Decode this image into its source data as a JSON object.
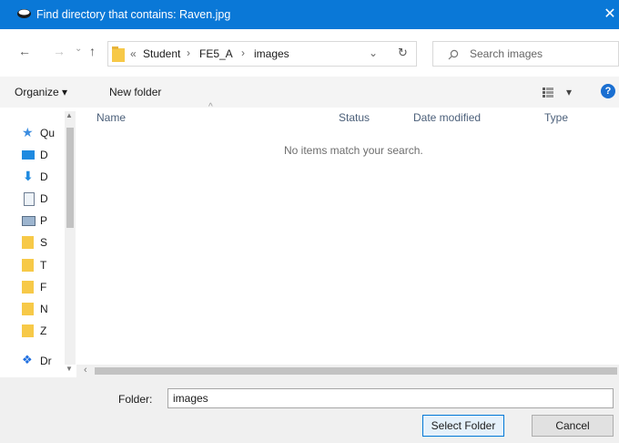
{
  "window": {
    "title": "Find directory that contains: Raven.jpg",
    "close_glyph": "✕"
  },
  "nav": {
    "back_glyph": "←",
    "forward_glyph": "→",
    "dropdown_glyph": "⌄",
    "up_glyph": "↑",
    "breadcrumb_prefix": "«",
    "crumbs": [
      "Student",
      "FE5_A",
      "images"
    ],
    "crumb_sep": "›",
    "refresh_glyph": "↻",
    "search_placeholder": "Search images"
  },
  "toolbar": {
    "organize_label": "Organize ▾",
    "new_folder_label": "New folder",
    "view_glyph": "▾",
    "help_glyph": "?"
  },
  "sidebar": {
    "items": [
      {
        "label": "Qu",
        "icon": "star-icon"
      },
      {
        "label": "D",
        "icon": "desktop-icon"
      },
      {
        "label": "D",
        "icon": "download-icon"
      },
      {
        "label": "D",
        "icon": "document-icon"
      },
      {
        "label": "P",
        "icon": "picture-icon"
      },
      {
        "label": "S",
        "icon": "folder-icon"
      },
      {
        "label": "T",
        "icon": "folder-icon"
      },
      {
        "label": "F",
        "icon": "folder-icon"
      },
      {
        "label": "N",
        "icon": "folder-icon"
      },
      {
        "label": "Z",
        "icon": "folder-icon"
      },
      {
        "label": "Dr",
        "icon": "dropbox-icon"
      }
    ]
  },
  "list": {
    "columns": [
      "Name",
      "Status",
      "Date modified",
      "Type"
    ],
    "empty_message": "No items match your search."
  },
  "footer": {
    "folder_label": "Folder:",
    "folder_value": "images",
    "select_label": "Select Folder",
    "cancel_label": "Cancel"
  },
  "colors": {
    "accent": "#0a78d7",
    "folder": "#f7c948"
  }
}
